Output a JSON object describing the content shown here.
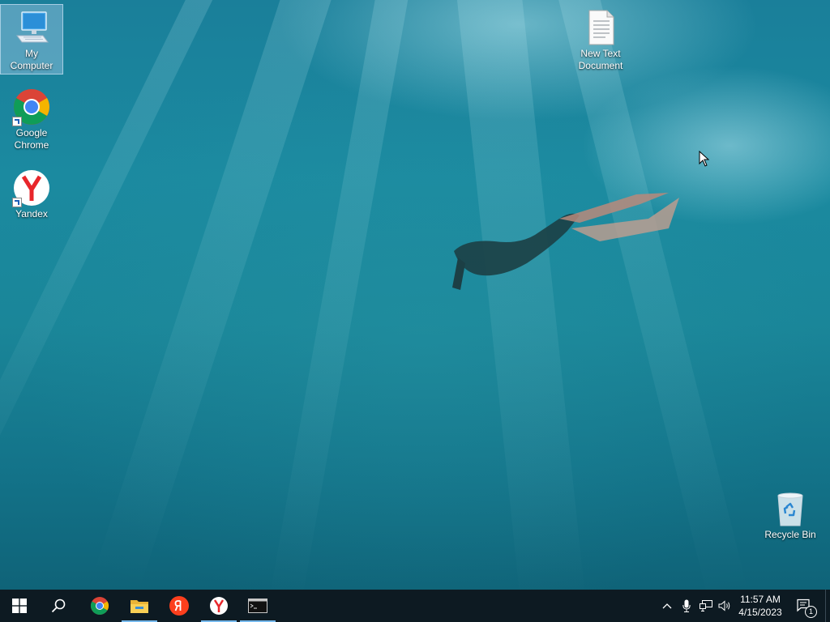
{
  "desktop": {
    "icons": [
      {
        "label": "My Computer",
        "icon": "computer-icon",
        "selected": true
      },
      {
        "label": "Google Chrome",
        "icon": "chrome-icon",
        "shortcut": true
      },
      {
        "label": "Yandex",
        "icon": "yandex-browser-icon",
        "shortcut": true
      },
      {
        "label": "New Text Document",
        "icon": "text-document-icon"
      },
      {
        "label": "Recycle Bin",
        "icon": "recycle-bin-icon"
      }
    ]
  },
  "taskbar": {
    "buttons": [
      {
        "icon": "windows-start-icon"
      },
      {
        "icon": "search-icon"
      },
      {
        "icon": "chrome-icon"
      },
      {
        "icon": "file-explorer-icon",
        "active": true
      },
      {
        "icon": "yandex-icon"
      },
      {
        "icon": "yandex-browser-icon",
        "active": true
      },
      {
        "icon": "command-prompt-icon",
        "active": true
      }
    ],
    "tray": {
      "icons": [
        "chevron-up-icon",
        "microphone-icon",
        "network-icon",
        "volume-icon"
      ],
      "time": "11:57 AM",
      "date": "4/15/2023",
      "notification_count": "1"
    }
  },
  "colors": {
    "taskbar_bg": "#0d1a22",
    "active_indicator": "#76b9ed",
    "water": "#1a8699"
  }
}
